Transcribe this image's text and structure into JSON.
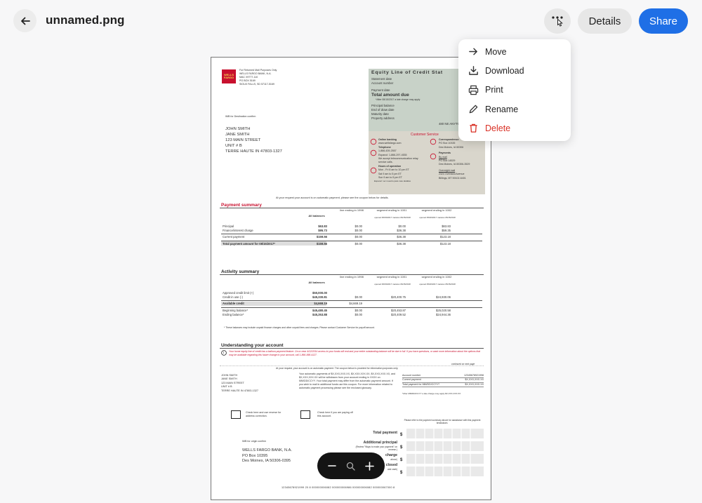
{
  "header": {
    "title": "unnamed.png",
    "details_label": "Details",
    "share_label": "Share"
  },
  "menu": {
    "items": [
      {
        "label": "Move",
        "icon": "arrow-right-icon"
      },
      {
        "label": "Download",
        "icon": "download-icon"
      },
      {
        "label": "Print",
        "icon": "printer-icon"
      },
      {
        "label": "Rename",
        "icon": "pencil-icon"
      },
      {
        "label": "Delete",
        "icon": "trash-icon"
      }
    ]
  },
  "colors": {
    "accent": "#1f6fe6",
    "danger": "#d93025",
    "bank_red": "#c8102e"
  },
  "document": {
    "logo_text": "WELLS FARGO",
    "return_addr": [
      "For Returned Mail Purposes Only",
      "WELLS FARGO BANK, N.A.",
      "MAC X9777-110",
      "PO BOX 5169",
      "SIOUX FALLS, SD 57117-5169"
    ],
    "imb_dest": "IMB for Destination confirm",
    "customer": [
      "JOHN SMITH",
      "JANE SMITH",
      "123 MAIN STREET",
      "UNIT # B",
      "TERRE HAUTE IN 47803-1327"
    ],
    "statement": {
      "title": "Equity Line of Credit Stat",
      "rows": [
        "Statement date",
        "Account number",
        "Payment date",
        "Total amount due",
        "*After 08/15/2017 a late charge may apply",
        "Principal balance",
        "End of draw date",
        "Maturity date",
        "Property address"
      ],
      "account_partial": "1234",
      "property_partial": "480 NE ANYTOWN STR"
    },
    "customer_service": {
      "title": "Customer Service",
      "left": [
        "Online banking",
        "www.wellsfargo.com",
        "Telephone",
        "1-866-439-2557",
        "Espanol: 1-866-297-4535",
        "We accept telecommunication relay service calls.",
        "Hours of operation",
        "Mon - Fri  8 am to 10 pm ET",
        "Sat         9 am to 5 pm ET",
        "Sun         9 am to 5 pm ET",
        "Espanol: ver nuestro para mas detalles"
      ],
      "right": [
        "Correspondence",
        "PO Box 10335",
        "Des Moines, IA 50306",
        "Payments",
        "By mail",
        "PO Box 14529",
        "Des Moines, IA 50306-3529",
        "Overnight mail",
        "2324 Overland Avenue",
        "Billings, MT 59102-6401"
      ]
    },
    "autopay_note": "At your request your account is on automatic payment, please see the coupon below for details.",
    "payment_summary": {
      "title": "Payment summary",
      "headers": [
        "All balances",
        "line ending in 1998",
        "segment ending in 1001",
        "segment ending in 1002"
      ],
      "subheaders": [
        "",
        "",
        "opened 06/03/2017 matures 06/15/2018",
        "opened 05/20/2017 matures 05/15/2018"
      ],
      "rows": [
        {
          "label": "Principal",
          "values": [
            "$63.83",
            "$0.00",
            "$0.00",
            "$63.83"
          ]
        },
        {
          "label": "Finance/interest charge",
          "values": [
            "$95.73",
            "$0.00",
            "$36.38",
            "$59.35"
          ]
        },
        {
          "label": "Current payment",
          "values": [
            "$159.56",
            "$0.00",
            "$36.38",
            "$123.18"
          ]
        },
        {
          "label": "Total payment amount for 08/15/2017*",
          "values": [
            "$159.56",
            "$0.00",
            "$36.38",
            "$123.18"
          ]
        }
      ]
    },
    "activity_summary": {
      "title": "Activity summary",
      "headers": [
        "All balances",
        "line ending in 1998",
        "segment ending in 1001",
        "segment ending in 1002"
      ],
      "subheaders": [
        "",
        "",
        "opened 06/03/2017 matures 06/15/2018",
        "opened 05/20/2017 matures 05/15/2018"
      ],
      "rows": [
        {
          "label": "Approved credit limit (+)",
          "values": [
            "$50,000.00",
            "",
            "",
            ""
          ]
        },
        {
          "label": "Credit in use (-)",
          "values": [
            "$45,330.81",
            "$0.00",
            "$20,400.75",
            "$24,930.06"
          ]
        },
        {
          "label": "Available credit",
          "values": [
            "$4,669.19",
            "$4,669.19",
            "",
            ""
          ]
        },
        {
          "label": "Beginning balance*",
          "values": [
            "$45,480.45",
            "$0.00",
            "$20,453.87",
            "$25,020.58"
          ]
        },
        {
          "label": "Ending balance*",
          "values": [
            "$45,353.88",
            "$0.00",
            "$20,409.52",
            "$24,944.36"
          ]
        }
      ],
      "note": "* These balances may include unpaid finance charges and other unpaid fees and charges.  Please contact Customer Service for payoff amount."
    },
    "understanding": {
      "title": "Understanding your account",
      "warning": "Your home equity line of credit has a balloon payment feature. On or near 4/12/2014 access to your funds will end and your entire outstanding balance will be due in full. If you have questions, or want more information about the options that may be available regarding this future change to your account, call 1-866-998-4127.",
      "continued": "continued on next page"
    },
    "coupon": {
      "note": "At your request, your account is on automatic payment. The coupon below is provided for information purposes only.",
      "customer": [
        "JOHN SMITH",
        "JANE SMITH",
        "123 MAIN STREET",
        "UNIT # B",
        "TERRE HAUTE IN 47803-1327"
      ],
      "autopay_text": "Your automatic payments of $X,XXX,XXX.XX, $X,XXX,XXX.XX, $X,XXX,XXX.XX, and $X,XXX,XXX.XX will be withdrawn from your account ending in XXXX on MM/DD/CCYY. Your total payment may differ from the automatic payment amount. If you wish to mail in additional funds use this coupon. For more information related to automatic payment processing please see the enclosed glossary.",
      "acct_rows": [
        {
          "label": "Account number",
          "value": "12345678921998"
        },
        {
          "label": "Current payment",
          "value": "$X,XXX,XXX.XX"
        },
        {
          "label": "Total payment for MM/DD/CCYY*",
          "value": "$X,XXX,XXX.XX"
        }
      ],
      "late_note": "*After MM/DD/CCYY a late charge may apply  $X,XXX,XXX.XX",
      "check1": "Check here and use reverse for address correction.",
      "check2": "Check here if you are paying off this account.",
      "refer_note": "Please refer to the payment summary above for assistance with this payment breakdown.",
      "pay_labels": [
        "Total payment",
        "Additional principal",
        "(Review \"Ways to make your payment\" on reverse.)",
        "charge",
        "above)",
        "closed",
        "and cash)"
      ],
      "imb_origin": "IMB for origin confirm",
      "bank_addr": [
        "WELLS FARGO BANK, N.A.",
        "PO Box 10395",
        "Des Moines, IA  50306-0395"
      ],
      "micr": "12345678921999 20 8 000000006082 000000006986 000000006082 000000067000 8"
    }
  }
}
